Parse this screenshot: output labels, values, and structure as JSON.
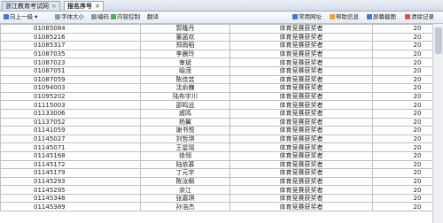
{
  "tabs": [
    {
      "label": "浙江教育考试网",
      "active": false
    },
    {
      "label": "报名序号",
      "active": true
    }
  ],
  "toolbar": {
    "back": "向上一级",
    "font_size": "字体大小",
    "encoding": "编码",
    "content_control": "内容控制",
    "translate": "翻译",
    "common_sites": "常用网址",
    "help": "帮助信息",
    "screenshot": "屏幕截图",
    "clear_traces": "清除记录"
  },
  "table": {
    "rows": [
      [
        "01085084",
        "郭隆丹",
        "体育竞赛获奖者",
        "20"
      ],
      [
        "01085216",
        "董菡欢",
        "体育竞赛获奖者",
        "20"
      ],
      [
        "01085317",
        "郑雨稻",
        "体育竞赛获奖者",
        "20"
      ],
      [
        "01087035",
        "李晨玲",
        "体育竞赛获奖者",
        "20"
      ],
      [
        "01087023",
        "审斌",
        "体育竞赛获奖者",
        "20"
      ],
      [
        "01087051",
        "喻滢",
        "体育竞赛获奖者",
        "20"
      ],
      [
        "01087059",
        "陈佳芸",
        "体育竞赛获奖者",
        "20"
      ],
      [
        "01094003",
        "沈俞巍",
        "体育竞赛获奖者",
        "20"
      ],
      [
        "01095202",
        "陆布宇川",
        "体育竞赛获奖者",
        "20"
      ],
      [
        "01115003",
        "邵鸣远",
        "体育竞赛获奖者",
        "20"
      ],
      [
        "01133006",
        "戚鸣",
        "体育竞赛获奖者",
        "20"
      ],
      [
        "01137052",
        "杨翼",
        "体育竞赛获奖者",
        "20"
      ],
      [
        "01141059",
        "谢书悦",
        "体育竞赛获奖者",
        "20"
      ],
      [
        "01145027",
        "刘哲琪",
        "体育竞赛获奖者",
        "20"
      ],
      [
        "01145071",
        "王星瑶",
        "体育竞赛获奖者",
        "20"
      ],
      [
        "01145168",
        "徐翎",
        "体育竞赛获奖者",
        "20"
      ],
      [
        "01145172",
        "陆依慕",
        "体育竞赛获奖者",
        "20"
      ],
      [
        "01145179",
        "丁元宇",
        "体育竞赛获奖者",
        "20"
      ],
      [
        "01145293",
        "陈汝枫",
        "体育竞赛获奖者",
        "20"
      ],
      [
        "01145295",
        "余江",
        "体育竞赛获奖者",
        "20"
      ],
      [
        "01145348",
        "张嘉琪",
        "体育竞赛获奖者",
        "20"
      ],
      [
        "01145389",
        "孙浩杰",
        "体育竞赛获奖者",
        "20"
      ]
    ]
  }
}
